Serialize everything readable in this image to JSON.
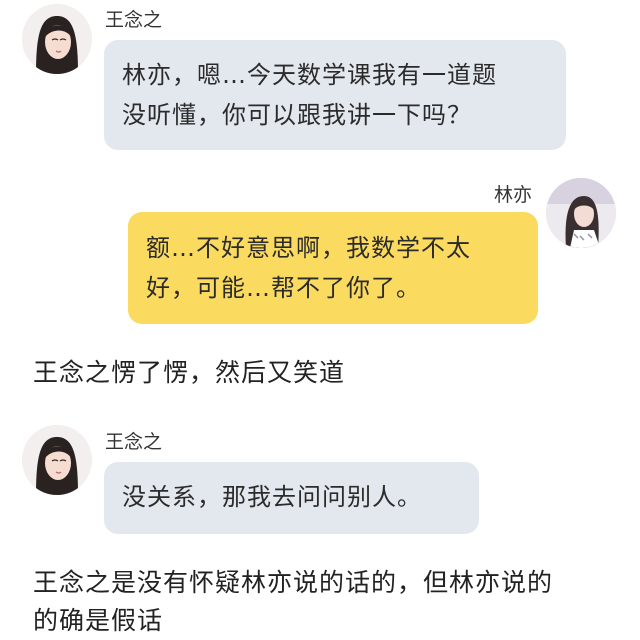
{
  "messages": [
    {
      "sender": "王念之",
      "side": "left",
      "avatar_icon": "girl-portrait-avatar",
      "lines": [
        "林亦，嗯…今天数学课我有一道题",
        "没听懂，你可以跟我讲一下吗？"
      ]
    },
    {
      "sender": "林亦",
      "side": "right",
      "avatar_icon": "girl-portrait-avatar",
      "lines": [
        "额…不好意思啊，我数学不太",
        "好，可能…帮不了你了。"
      ]
    },
    {
      "sender": "王念之",
      "side": "left",
      "avatar_icon": "girl-portrait-avatar",
      "lines": [
        "没关系，那我去问问别人。"
      ]
    }
  ],
  "narrations": [
    {
      "lines": [
        "王念之愣了愣，然后又笑道"
      ]
    },
    {
      "lines": [
        "王念之是没有怀疑林亦说的话的，但林亦说的",
        "的确是假话"
      ]
    }
  ],
  "colors": {
    "left_bubble": "#e3e8ef",
    "right_bubble": "#fbdb5f",
    "text": "#222222"
  }
}
